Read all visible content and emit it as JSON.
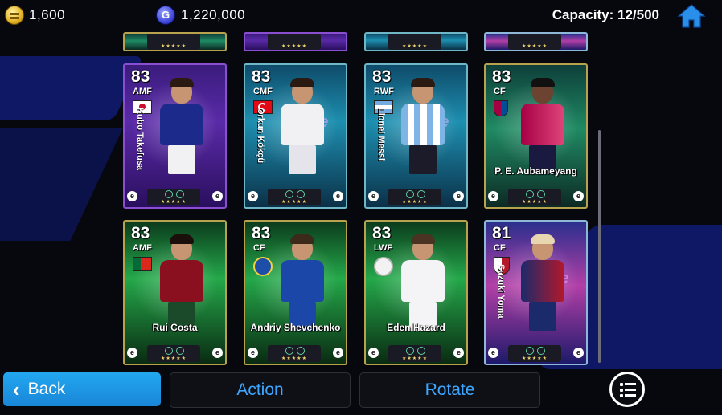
{
  "currency": {
    "coins": "1,600",
    "gp": "1,220,000",
    "gp_symbol": "G"
  },
  "capacity": "Capacity: 12/500",
  "cards_row2": [
    {
      "rating": "83",
      "position": "AMF",
      "name": "Kubo Takefusa"
    },
    {
      "rating": "83",
      "position": "CMF",
      "name": "Orkun Kökçü"
    },
    {
      "rating": "83",
      "position": "RWF",
      "name": "Lionel Messi"
    },
    {
      "rating": "83",
      "position": "CF",
      "name": "P. E. Aubameyang"
    }
  ],
  "cards_row3": [
    {
      "rating": "83",
      "position": "AMF",
      "name": "Rui Costa"
    },
    {
      "rating": "83",
      "position": "CF",
      "name": "Andriy Shevchenko"
    },
    {
      "rating": "83",
      "position": "LWF",
      "name": "Eden Hazard"
    },
    {
      "rating": "81",
      "position": "CF",
      "name": "Suzuki Yoma"
    }
  ],
  "card_brand_letter": "e",
  "stars": "★★★★★",
  "holo_text": "he",
  "buttons": {
    "back": "Back",
    "action": "Action",
    "rotate": "Rotate"
  },
  "colors": {
    "accent_blue": "#22a7ef",
    "button_text_blue": "#3fa6ff"
  },
  "icons": [
    "coin-icon",
    "gp-icon",
    "home-icon",
    "chevron-left-icon",
    "list-menu-icon"
  ]
}
